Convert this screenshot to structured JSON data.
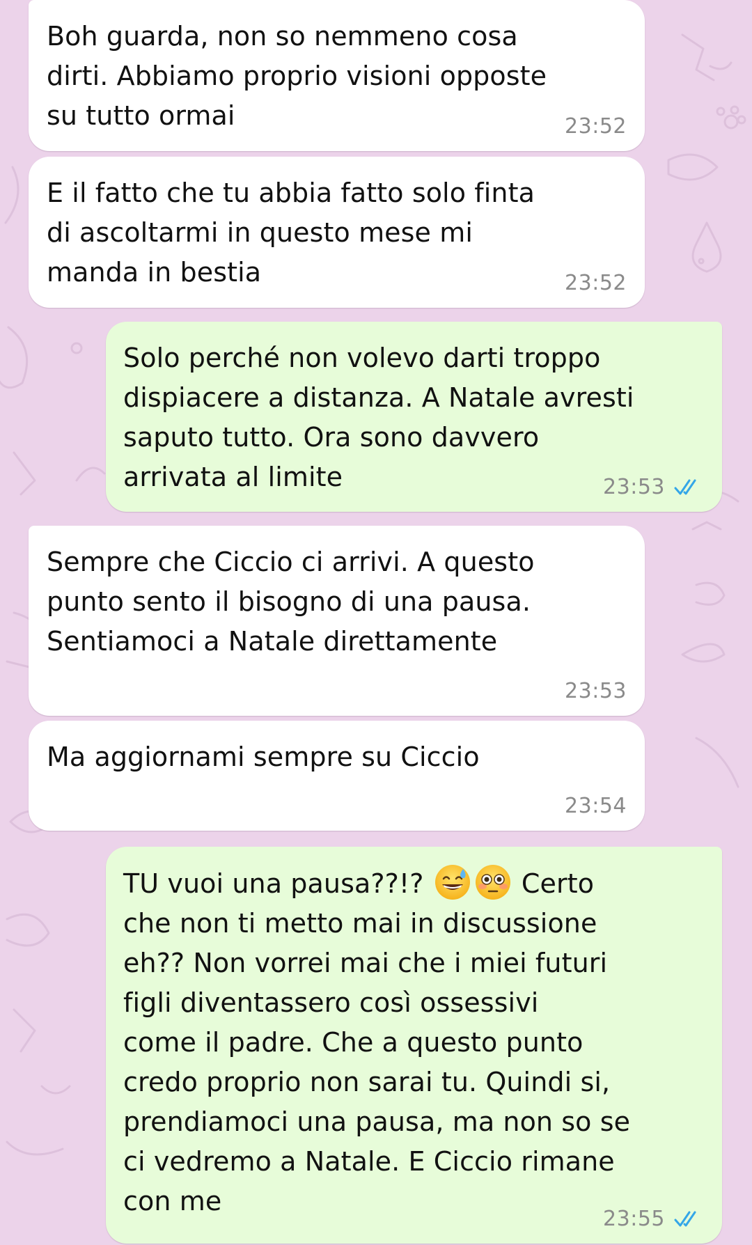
{
  "theme": {
    "wallpaper_color": "#ecd3ea",
    "incoming_bubble_color": "#ffffff",
    "outgoing_bubble_color": "#e7fcd9",
    "read_check_color": "#34a6e8"
  },
  "messages": [
    {
      "direction": "incoming",
      "lines": [
        "Boh guarda, non so nemmeno cosa",
        "dirti. Abbiamo proprio visioni opposte",
        "su tutto ormai"
      ],
      "time": "23:52"
    },
    {
      "direction": "incoming",
      "lines": [
        "E il fatto che tu abbia fatto solo finta",
        "di ascoltarmi in questo mese mi",
        "manda in bestia"
      ],
      "time": "23:52"
    },
    {
      "direction": "outgoing",
      "lines": [
        "Solo perché non volevo darti troppo",
        "dispiacere a distanza. A Natale avresti",
        "saputo tutto. Ora sono davvero",
        "arrivata al limite"
      ],
      "time": "23:53",
      "status_icon": "double-check-read-icon"
    },
    {
      "direction": "incoming",
      "lines": [
        "Sempre che Ciccio ci arrivi. A questo",
        "punto sento il bisogno di una pausa.",
        "Sentiamoci a Natale direttamente"
      ],
      "time": "23:53"
    },
    {
      "direction": "incoming",
      "lines": [
        "Ma aggiornami sempre su Ciccio"
      ],
      "time": "23:54"
    },
    {
      "direction": "outgoing",
      "first_line": {
        "before_emoji": "TU vuoi una pausa??!? ",
        "emojis": [
          "grinning-face-with-sweat-emoji",
          "flushed-face-emoji"
        ],
        "after_emoji": " Certo"
      },
      "lines": [
        "che non ti metto mai in discussione",
        "eh?? Non vorrei mai che i miei futuri",
        "figli diventassero così ossessivi",
        "come il padre. Che a questo punto",
        "credo proprio non sarai tu. Quindi si,",
        "prendiamoci una pausa, ma non so se",
        "ci vedremo a Natale. E Ciccio rimane",
        "con me"
      ],
      "time": "23:55",
      "status_icon": "double-check-read-icon"
    }
  ]
}
